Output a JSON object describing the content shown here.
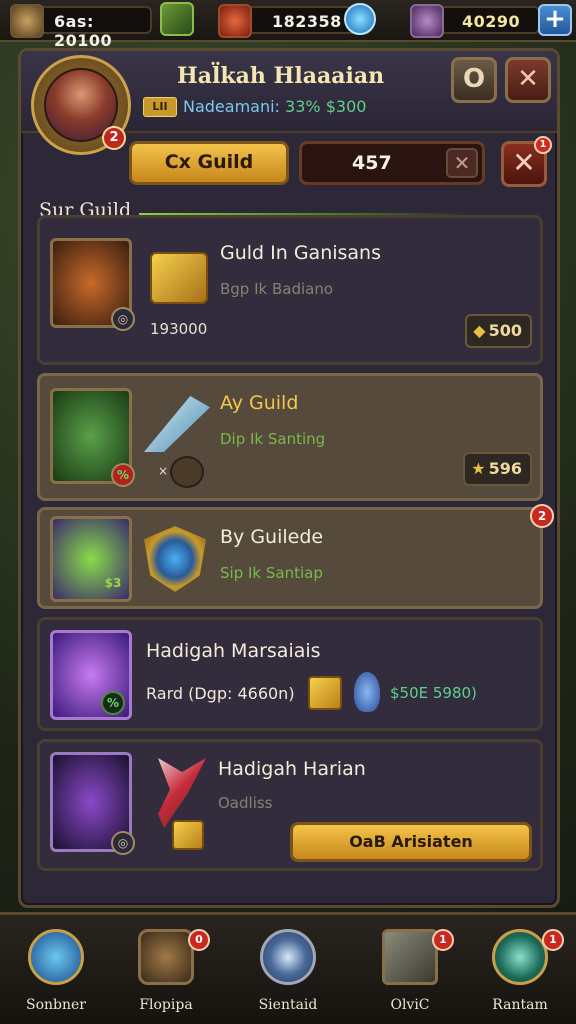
{
  "resources": [
    {
      "icon": "gear-resource-icon",
      "value": "6as: 20100",
      "color": "#8a7048"
    },
    {
      "icon": "ruby-icon",
      "value": "182358",
      "color": "#b83a2a"
    },
    {
      "icon": "shield-icon",
      "value": "40290",
      "color": "#7a4a8a"
    }
  ],
  "add_button": "+",
  "player": {
    "name": "Hal̈kah Hlaaaian",
    "level_tag": "LII",
    "subtitle_prefix": "Nadeamani:",
    "subtitle_pct": "33%",
    "subtitle_gold": "$300",
    "avatar_badge": "2"
  },
  "header_buttons": {
    "info": "O",
    "close": "✕"
  },
  "guild_bar": {
    "guild_button": "Cx Guild",
    "count": "457",
    "clear": "✕",
    "close": "✕",
    "close_badge": "1"
  },
  "section": {
    "title": "Sur Guild"
  },
  "cards": [
    {
      "title": "Guld In Ganisans",
      "subtitle": "Bgp Ik Badiano",
      "amount": "193000",
      "price": "500",
      "thumb_color": "#6a3a1a",
      "corner": "◎"
    },
    {
      "title": "Ay Guild",
      "subtitle": "Dip Ik Santing",
      "price": "596",
      "thumb_color": "#2e6a2a",
      "corner": "%",
      "extra": "×"
    },
    {
      "title": "By Guilede",
      "subtitle": "Sip Ik Santiap",
      "badge": "2",
      "thumb_color": "#4a3a7a",
      "corner": "$3"
    },
    {
      "title": "Hadigah Marsaiais",
      "subtitle": "Rard (Dgp: 4660n)",
      "reward_text": "$50E 5980)",
      "thumb_color": "#4a2a7a",
      "corner": "%"
    },
    {
      "title": "Hadigah Harian",
      "subtitle": "Oadliss",
      "cta": "OaB Arisiaten",
      "thumb_color": "#2a1e4a",
      "corner": "◎"
    }
  ],
  "bottom_nav": [
    {
      "label": "Sonbner",
      "icon": "spiral-shield-icon",
      "badge": ""
    },
    {
      "label": "Flopipa",
      "icon": "bag-icon",
      "badge": "0"
    },
    {
      "label": "Sientaid",
      "icon": "compass-icon",
      "badge": ""
    },
    {
      "label": "OlviC",
      "icon": "anvil-icon",
      "badge": "1"
    },
    {
      "label": "Rantam",
      "icon": "magnifier-icon",
      "badge": "1"
    }
  ]
}
